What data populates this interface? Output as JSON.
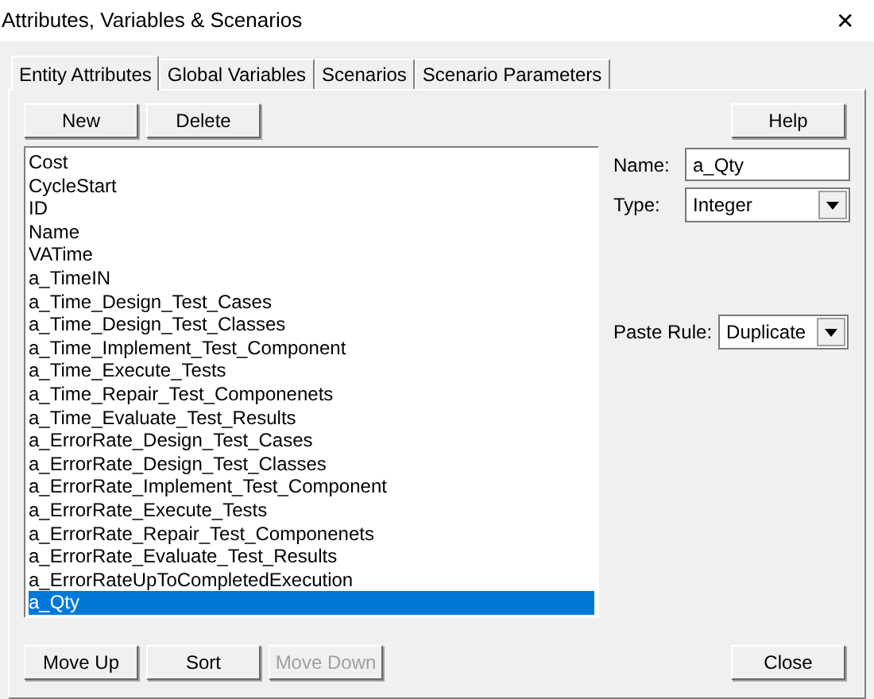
{
  "window": {
    "title": "Attributes, Variables & Scenarios",
    "close": "✕"
  },
  "tabs": [
    {
      "label": "Entity Attributes",
      "selected": true
    },
    {
      "label": "Global Variables",
      "selected": false
    },
    {
      "label": "Scenarios",
      "selected": false
    },
    {
      "label": "Scenario Parameters",
      "selected": false
    }
  ],
  "top_buttons": [
    {
      "label": "New",
      "disabled": false
    },
    {
      "label": "Delete",
      "disabled": false
    }
  ],
  "help_button": {
    "label": "Help",
    "disabled": false
  },
  "attributes": [
    {
      "label": "Cost",
      "selected": false
    },
    {
      "label": "CycleStart",
      "selected": false
    },
    {
      "label": "ID",
      "selected": false
    },
    {
      "label": "Name",
      "selected": false
    },
    {
      "label": "VATime",
      "selected": false
    },
    {
      "label": "a_TimeIN",
      "selected": false
    },
    {
      "label": "a_Time_Design_Test_Cases",
      "selected": false
    },
    {
      "label": "a_Time_Design_Test_Classes",
      "selected": false
    },
    {
      "label": "a_Time_Implement_Test_Component",
      "selected": false
    },
    {
      "label": "a_Time_Execute_Tests",
      "selected": false
    },
    {
      "label": "a_Time_Repair_Test_Componenets",
      "selected": false
    },
    {
      "label": "a_Time_Evaluate_Test_Results",
      "selected": false
    },
    {
      "label": "a_ErrorRate_Design_Test_Cases",
      "selected": false
    },
    {
      "label": "a_ErrorRate_Design_Test_Classes",
      "selected": false
    },
    {
      "label": "a_ErrorRate_Implement_Test_Component",
      "selected": false
    },
    {
      "label": "a_ErrorRate_Execute_Tests",
      "selected": false
    },
    {
      "label": "a_ErrorRate_Repair_Test_Componenets",
      "selected": false
    },
    {
      "label": "a_ErrorRate_Evaluate_Test_Results",
      "selected": false
    },
    {
      "label": "a_ErrorRateUpToCompletedExecution",
      "selected": false
    },
    {
      "label": "a_Qty",
      "selected": true
    }
  ],
  "name_field": {
    "label": "Name:",
    "value": "a_Qty"
  },
  "type_field": {
    "label": "Type:",
    "value": "Integer"
  },
  "paste_rule": {
    "label": "Paste Rule:",
    "value": "Duplicate"
  },
  "bottom_buttons": [
    {
      "label": "Move Up",
      "disabled": false
    },
    {
      "label": "Sort",
      "disabled": false
    },
    {
      "label": "Move Down",
      "disabled": true
    }
  ],
  "close_button": {
    "label": "Close",
    "disabled": false
  }
}
